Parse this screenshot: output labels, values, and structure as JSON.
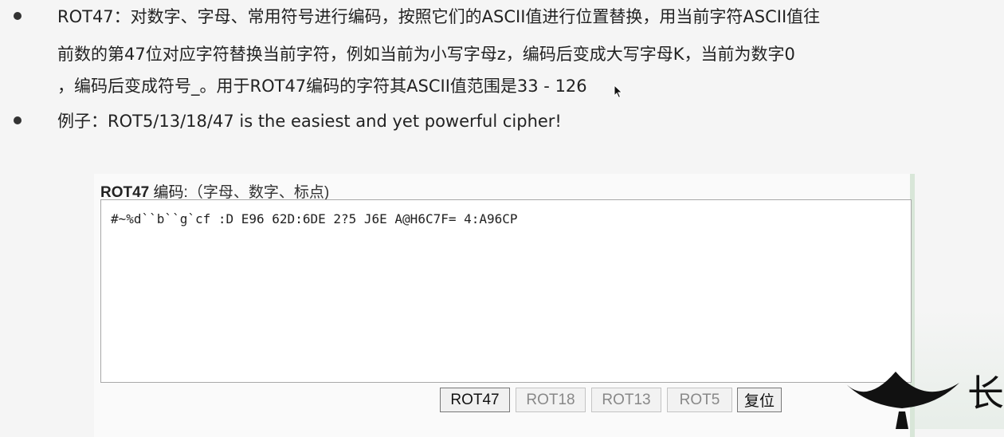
{
  "bullets": [
    {
      "lines": [
        "ROT47：对数字、字母、常用符号进行编码，按照它们的ASCII值进行位置替换，用当前字符ASCII值往",
        "前数的第47位对应字符替换当前字符，例如当前为小写字母z，编码后变成大写字母K，当前为数字0",
        "，编码后变成符号_。用于ROT47编码的字符其ASCII值范围是33 - 126"
      ]
    },
    {
      "lines": [
        "例子：ROT5/13/18/47 is the easiest and yet powerful cipher!"
      ]
    }
  ],
  "panel": {
    "title_bold": "ROT47",
    "title_rest": " 编码:",
    "title_hint": "（字母、数字、标点)",
    "textarea_value": "#~%d``b``g`cf :D E96 62D:6DE 2?5 J6E A@H6C7F= 4:A96CP"
  },
  "buttons": {
    "rot47": "ROT47",
    "rot18": "ROT18",
    "rot13": "ROT13",
    "rot5": "ROT5",
    "reset": "复位"
  },
  "logo": {
    "char": "长"
  },
  "icons": {
    "cursor": "mouse-pointer-icon",
    "bullet": "bullet-dot-icon",
    "logo": "roof-logo-icon"
  }
}
